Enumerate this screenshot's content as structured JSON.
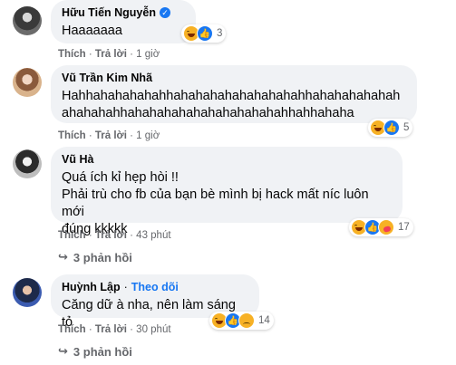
{
  "colors": {
    "bubble": "#f0f2f5",
    "link_blue": "#1877f2",
    "meta_gray": "#65676b",
    "haha_yellow": "#f7b125"
  },
  "comments": [
    {
      "name": "Hữu Tiến Nguyễn",
      "verified": true,
      "text": "Haaaaaaa",
      "like_label": "Thích",
      "reply_label": "Trả lời",
      "time": "1 giờ",
      "reactions": [
        "haha-icon",
        "like-icon"
      ],
      "reaction_count": "3"
    },
    {
      "name": "Vũ Trần Kim Nhã",
      "verified": false,
      "text": "Hahhahahahahahhahahahahahahahahahhahahahahahah\nahahahahhahahahahahahahahahahahhahhahaha",
      "like_label": "Thích",
      "reply_label": "Trả lời",
      "time": "1 giờ",
      "reactions": [
        "haha-icon",
        "like-icon"
      ],
      "reaction_count": "5"
    },
    {
      "name": "Vũ Hà",
      "verified": false,
      "text": "Quá ích kỉ hẹp hòi !!\nPhải trù cho fb của bạn bè mình bị hack mất níc luôn mới\nđúng kkkkk",
      "like_label": "Thích",
      "reply_label": "Trả lời",
      "time": "43 phút",
      "reactions": [
        "haha-icon",
        "like-icon",
        "care-icon"
      ],
      "reaction_count": "17",
      "replies_label": "3 phản hồi"
    },
    {
      "name": "Huỳnh Lập",
      "verified": false,
      "follow_label": "Theo dõi",
      "text": "Căng dữ à nha, nên làm sáng tỏ",
      "like_label": "Thích",
      "reply_label": "Trả lời",
      "time": "30 phút",
      "reactions": [
        "haha-icon",
        "like-icon",
        "sad-icon"
      ],
      "reaction_count": "14",
      "replies_label": "3 phản hồi"
    }
  ]
}
